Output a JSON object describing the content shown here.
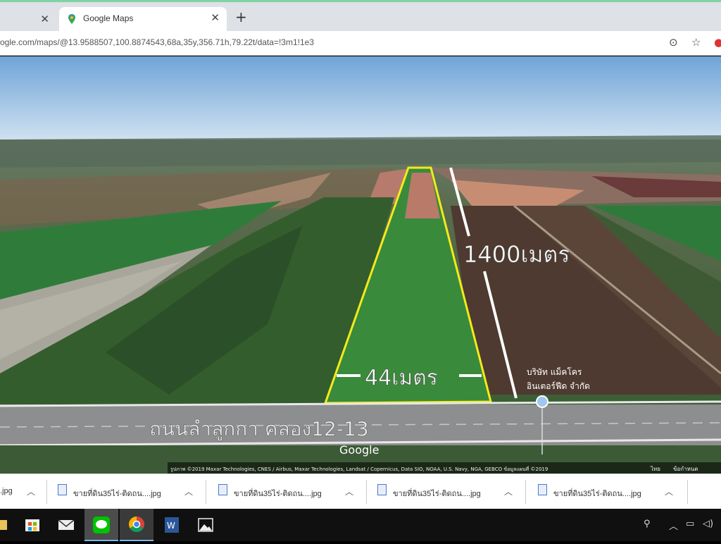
{
  "browser": {
    "tabs": [
      {
        "label": "",
        "active": false
      },
      {
        "label": "Google Maps",
        "active": true
      }
    ],
    "address": "ogle.com/maps/@13.9588507,100.8874543,68a,35y,356.71h,79.22t/data=!3m1!1e3"
  },
  "map": {
    "labels": {
      "length": "1400เมตร",
      "width": "44เมตร",
      "road": "ถนนลำลูกกา คลอง12-13",
      "company_line1": "บริษัท แม็คโคร",
      "company_line2": "อินเตอร์ฟีด จำกัด",
      "google": "Google",
      "attribution": "รูปภาพ ©2019 Maxar Technologies, CNES / Airbus, Maxar Technologies, Landsat / Copernicus, Data SIO, NOAA, U.S. Navy, NGA, GEBCO ข้อมูลแผนที่ ©2019",
      "terms_1": "ไทย",
      "terms_2": "ข้อกำหนด"
    },
    "colors": {
      "plot_outline": "#f5ea1a",
      "sky_top": "#6fa4d8",
      "sky_bottom": "#cfe1f1"
    }
  },
  "downloads": [
    {
      "name": ".jpg"
    },
    {
      "name": "ขายที่ดิน35ไร่-ติดถน....jpg"
    },
    {
      "name": "ขายที่ดิน35ไร่-ติดถน....jpg"
    },
    {
      "name": "ขายที่ดิน35ไร่-ติดถน....jpg"
    },
    {
      "name": "ขายที่ดิน35ไร่-ติดถน....jpg"
    }
  ],
  "taskbar": {
    "icons": [
      "store-icon",
      "mail-icon",
      "line-app-icon",
      "chrome-icon",
      "word-icon",
      "photos-icon"
    ],
    "tray": [
      "person-icon",
      "chevron-up-icon",
      "network-icon",
      "speaker-icon"
    ]
  }
}
